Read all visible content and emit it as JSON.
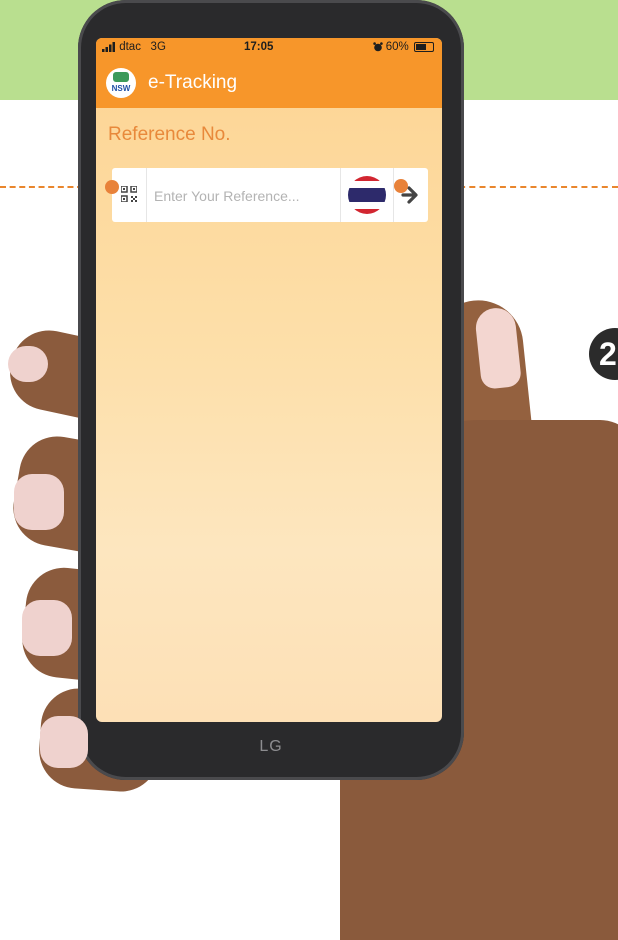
{
  "status_bar": {
    "carrier": "dtac",
    "network": "3G",
    "time": "17:05",
    "battery": "60%"
  },
  "app": {
    "logo_text": "NSW",
    "title": "e-Tracking"
  },
  "form": {
    "label": "Reference No.",
    "input_placeholder": "Enter Your Reference...",
    "input_value": ""
  },
  "device": {
    "brand": "LG"
  },
  "annotation": {
    "step_number": "2"
  },
  "colors": {
    "accent": "#f7962a",
    "label": "#e8893b",
    "band": "#b9df8f",
    "callout": "#e8823a"
  },
  "icons": {
    "qr": "qr-code-icon",
    "flag": "thailand-flag-icon",
    "submit": "arrow-right-icon",
    "alarm": "alarm-icon",
    "signal": "signal-bars-icon"
  }
}
